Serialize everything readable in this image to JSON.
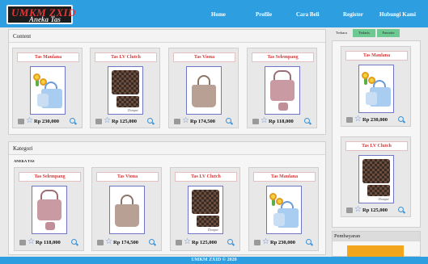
{
  "brand": {
    "line1": "UMKM ZXID",
    "line2": "Aneka Tas"
  },
  "nav": [
    "Home",
    "Profile",
    "Cara Beli",
    "Register",
    "Hubungi Kami"
  ],
  "content": {
    "title": "Content"
  },
  "kategori": {
    "title": "Kategori",
    "subtitle": "ANEKA TAS"
  },
  "sidebar": {
    "tabs": [
      "Terbaru",
      "Terlaris",
      "Favorite"
    ],
    "products": [
      {
        "name": "Tas Maulana",
        "price": "Rp 230,000"
      },
      {
        "name": "Tas LV Clutch",
        "price": "Rp 125,000"
      }
    ],
    "pembayaran": "Pembayaran"
  },
  "products_content": [
    {
      "name": "Tas Maulana",
      "price": "Rp 230,000",
      "image": "blue-handbag-with-sunflowers"
    },
    {
      "name": "Tas LV Clutch",
      "price": "Rp 125,000",
      "image": "brown-checkered-bag"
    },
    {
      "name": "Tas Viona",
      "price": "Rp 174,500",
      "image": "taupe-tote-bag"
    },
    {
      "name": "Tas Selempang",
      "price": "Rp 118,000",
      "image": "mauve-sling-bag"
    }
  ],
  "products_kategori": [
    {
      "name": "Tas Selempang",
      "price": "Rp 118,000",
      "image": "mauve-sling-bag"
    },
    {
      "name": "Tas Viona",
      "price": "Rp 174,500",
      "image": "taupe-tote-bag"
    },
    {
      "name": "Tas LV Clutch",
      "price": "Rp 125,000",
      "image": "brown-checkered-bag"
    },
    {
      "name": "Tas Maulana",
      "price": "Rp 230,000",
      "image": "blue-handbag-with-sunflowers"
    }
  ],
  "image_tag": "Dompet",
  "footer": "UMKM ZXID © 2020",
  "colors": {
    "header": "#2d9fe0",
    "price_title": "#d63a3a",
    "tab_green": "#6dc992"
  }
}
